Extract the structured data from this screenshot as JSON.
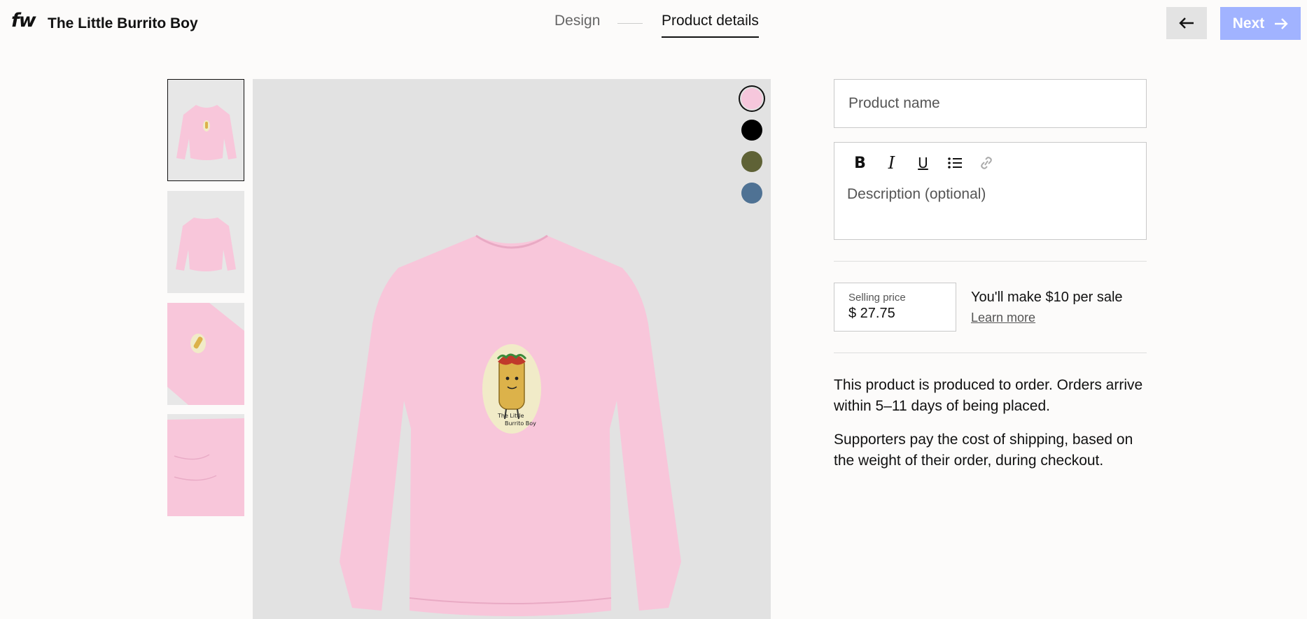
{
  "header": {
    "logo": "fw",
    "brand_name": "The Little Burrito Boy",
    "steps": [
      "Design",
      "Product details"
    ],
    "next_label": "Next"
  },
  "colors": {
    "accent_disabled": "#a1b3ff",
    "shirt": "#f8c6da",
    "swatches": [
      "#f6c7dc",
      "#000000",
      "#5f6236",
      "#4f7294"
    ]
  },
  "thumbnails": [
    "front view",
    "back view",
    "sleeve view",
    "folded view"
  ],
  "selected_swatch": 0,
  "print": {
    "text": "The Little Burrito Boy"
  },
  "form": {
    "name_placeholder": "Product name",
    "description_placeholder": "Description (optional)",
    "toolbar": [
      "bold",
      "italic",
      "underline",
      "bulleted-list",
      "link"
    ],
    "price_label": "Selling price",
    "price_value": "$ 27.75",
    "earn_text": "You'll make $10 per sale",
    "learn_more": "Learn more",
    "info_1": "This product is produced to order. Orders arrive within 5–11 days of being placed.",
    "info_2": "Supporters pay the cost of shipping, based on the weight of their order, during checkout."
  }
}
